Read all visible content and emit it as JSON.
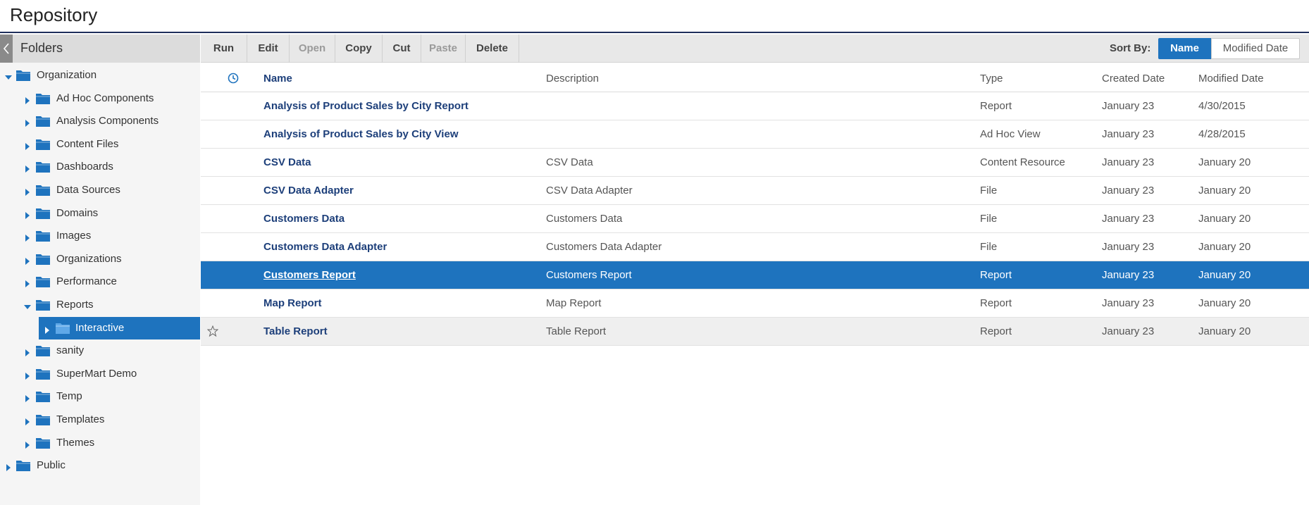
{
  "page": {
    "title": "Repository"
  },
  "sidebar": {
    "header": "Folders",
    "items": [
      {
        "label": "Organization",
        "level": 0,
        "expanded": true
      },
      {
        "label": "Ad Hoc Components",
        "level": 1,
        "expanded": false
      },
      {
        "label": "Analysis Components",
        "level": 1,
        "expanded": false
      },
      {
        "label": "Content Files",
        "level": 1,
        "expanded": false
      },
      {
        "label": "Dashboards",
        "level": 1,
        "expanded": false
      },
      {
        "label": "Data Sources",
        "level": 1,
        "expanded": false
      },
      {
        "label": "Domains",
        "level": 1,
        "expanded": false
      },
      {
        "label": "Images",
        "level": 1,
        "expanded": false
      },
      {
        "label": "Organizations",
        "level": 1,
        "expanded": false
      },
      {
        "label": "Performance",
        "level": 1,
        "expanded": false
      },
      {
        "label": "Reports",
        "level": 1,
        "expanded": true
      },
      {
        "label": "Interactive",
        "level": 2,
        "expanded": false,
        "selected": true
      },
      {
        "label": "sanity",
        "level": 1,
        "expanded": false
      },
      {
        "label": "SuperMart Demo",
        "level": 1,
        "expanded": false
      },
      {
        "label": "Temp",
        "level": 1,
        "expanded": false
      },
      {
        "label": "Templates",
        "level": 1,
        "expanded": false
      },
      {
        "label": "Themes",
        "level": 1,
        "expanded": false
      },
      {
        "label": "Public",
        "level": 0,
        "expanded": false
      }
    ]
  },
  "toolbar": {
    "buttons": [
      {
        "label": "Run",
        "enabled": true
      },
      {
        "label": "Edit",
        "enabled": true
      },
      {
        "label": "Open",
        "enabled": false
      },
      {
        "label": "Copy",
        "enabled": true
      },
      {
        "label": "Cut",
        "enabled": true
      },
      {
        "label": "Paste",
        "enabled": false
      },
      {
        "label": "Delete",
        "enabled": true
      }
    ],
    "sort_label": "Sort By:",
    "sort_options": [
      {
        "label": "Name",
        "active": true
      },
      {
        "label": "Modified Date",
        "active": false
      }
    ]
  },
  "table": {
    "columns": [
      "Name",
      "Description",
      "Type",
      "Created Date",
      "Modified Date"
    ],
    "rows": [
      {
        "name": "Analysis of Product Sales by City Report",
        "description": "",
        "type": "Report",
        "created": "January 23",
        "modified": "4/30/2015"
      },
      {
        "name": "Analysis of Product Sales by City View",
        "description": "",
        "type": "Ad Hoc View",
        "created": "January 23",
        "modified": "4/28/2015"
      },
      {
        "name": "CSV Data",
        "description": "CSV Data",
        "type": "Content Resource",
        "created": "January 23",
        "modified": "January 20"
      },
      {
        "name": "CSV Data Adapter",
        "description": "CSV Data Adapter",
        "type": "File",
        "created": "January 23",
        "modified": "January 20"
      },
      {
        "name": "Customers Data",
        "description": "Customers Data",
        "type": "File",
        "created": "January 23",
        "modified": "January 20"
      },
      {
        "name": "Customers Data Adapter",
        "description": "Customers Data Adapter",
        "type": "File",
        "created": "January 23",
        "modified": "January 20"
      },
      {
        "name": "Customers Report",
        "description": "Customers Report",
        "type": "Report",
        "created": "January 23",
        "modified": "January 20",
        "selected": true
      },
      {
        "name": "Map Report",
        "description": "Map Report",
        "type": "Report",
        "created": "January 23",
        "modified": "January 20"
      },
      {
        "name": "Table Report",
        "description": "Table Report",
        "type": "Report",
        "created": "January 23",
        "modified": "January 20",
        "hover": true
      }
    ]
  },
  "colors": {
    "accent": "#1e73be",
    "link": "#1d3f7a",
    "folder": "#1e73be"
  }
}
